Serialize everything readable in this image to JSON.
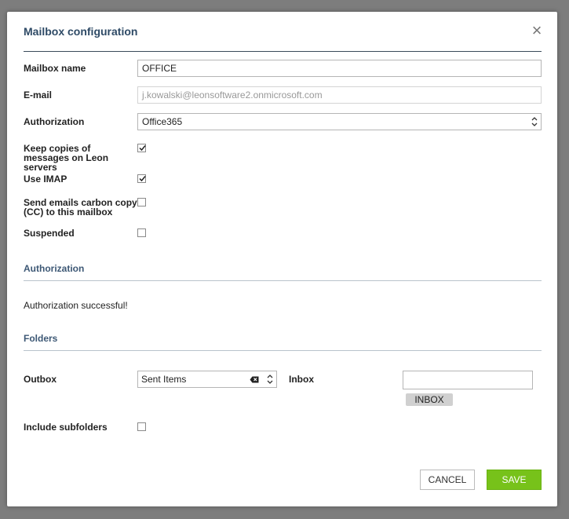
{
  "dialog": {
    "title": "Mailbox configuration",
    "close_icon": "close-icon"
  },
  "fields": {
    "mailbox_name": {
      "label": "Mailbox name",
      "value": "OFFICE"
    },
    "email": {
      "label": "E-mail",
      "placeholder": "j.kowalski@leonsoftware2.onmicrosoft.com"
    },
    "authorization": {
      "label": "Authorization",
      "value": "Office365"
    },
    "keep_copies": {
      "label": "Keep copies of messages on Leon servers",
      "checked": true
    },
    "use_imap": {
      "label": "Use IMAP",
      "checked": true
    },
    "send_cc": {
      "label": "Send emails carbon copy (CC) to this mailbox",
      "checked": false
    },
    "suspended": {
      "label": "Suspended",
      "checked": false
    }
  },
  "authorization_section": {
    "heading": "Authorization",
    "status": "Authorization successful!"
  },
  "folders_section": {
    "heading": "Folders",
    "outbox": {
      "label": "Outbox",
      "value": "Sent Items"
    },
    "inbox": {
      "label": "Inbox",
      "value": "",
      "tag": "INBOX"
    },
    "include_subfolders": {
      "label": "Include subfolders",
      "checked": false
    }
  },
  "buttons": {
    "cancel": "CANCEL",
    "save": "SAVE"
  },
  "colors": {
    "title": "#2e4a66",
    "section": "#3d5875",
    "save": "#77c21a"
  }
}
